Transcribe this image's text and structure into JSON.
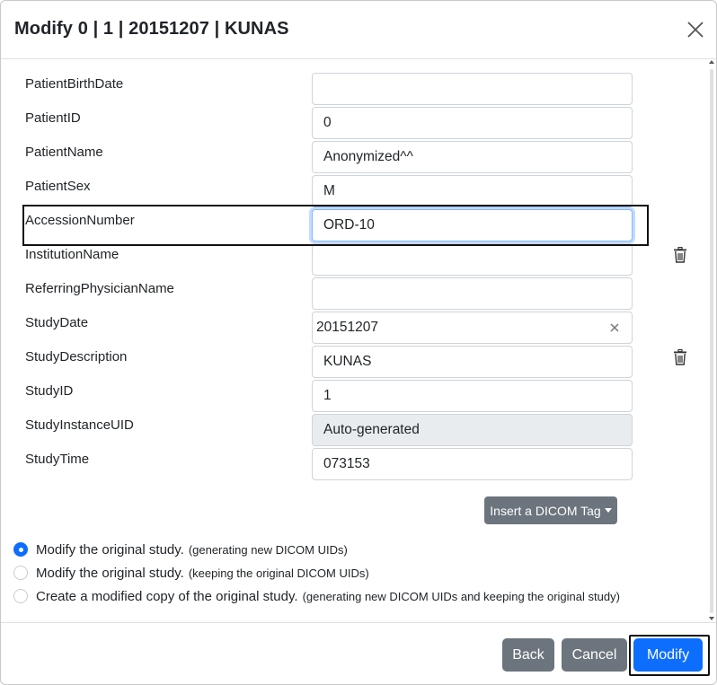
{
  "dialog": {
    "title": "Modify 0 | 1 | 20151207 | KUNAS"
  },
  "fields": [
    {
      "label": "PatientBirthDate",
      "value": ""
    },
    {
      "label": "PatientID",
      "value": "0"
    },
    {
      "label": "PatientName",
      "value": "Anonymized^^"
    },
    {
      "label": "PatientSex",
      "value": "M"
    },
    {
      "label": "AccessionNumber",
      "value": "ORD-10"
    },
    {
      "label": "InstitutionName",
      "value": ""
    },
    {
      "label": "ReferringPhysicianName",
      "value": ""
    },
    {
      "label": "StudyDate",
      "value": "20151207"
    },
    {
      "label": "StudyDescription",
      "value": "KUNAS"
    },
    {
      "label": "StudyID",
      "value": "1"
    },
    {
      "label": "StudyInstanceUID",
      "value": "Auto-generated"
    },
    {
      "label": "StudyTime",
      "value": "073153"
    }
  ],
  "insert_tag_button": "Insert a DICOM Tag",
  "options": [
    {
      "label": "Modify the original study.",
      "note": "(generating new DICOM UIDs)",
      "checked": true
    },
    {
      "label": "Modify the original study.",
      "note": "(keeping the original DICOM UIDs)",
      "checked": false
    },
    {
      "label": "Create a modified copy of the original study.",
      "note": "(generating new DICOM UIDs and keeping the original study)",
      "checked": false
    }
  ],
  "footer": {
    "back": "Back",
    "cancel": "Cancel",
    "modify": "Modify"
  },
  "colors": {
    "primary": "#0d6efd",
    "secondary": "#6c757d",
    "disabled_bg": "#e9ecef"
  },
  "icons": [
    "close-icon",
    "trash-icon",
    "clear-icon",
    "caret-down-icon"
  ]
}
